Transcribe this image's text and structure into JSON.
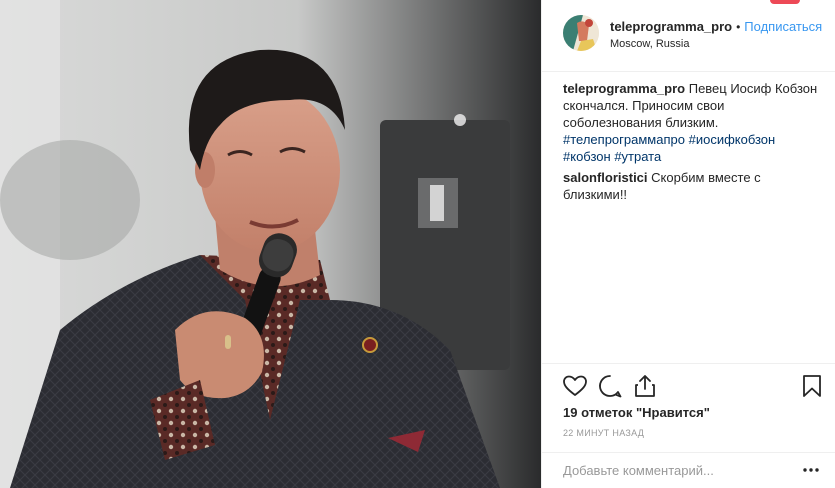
{
  "post": {
    "username": "teleprogramma_pro",
    "separator": "•",
    "follow_label": "Подписаться",
    "location": "Moscow, Russia"
  },
  "caption": {
    "username": "teleprogramma_pro",
    "text": "Певец Иосиф Кобзон скончался. Приносим свои соболезнования близким.",
    "hashtags": [
      "#телепрограммапро",
      "#иосифкобзон",
      "#кобзон",
      "#утрата"
    ]
  },
  "comments": [
    {
      "username": "salonfloristici",
      "text": "Скорбим вместе с близкими!!"
    }
  ],
  "actions": {
    "likes_text": "19 отметок \"Нравится\"",
    "time_ago": "22 МИНУТ НАЗАД",
    "comment_placeholder": "Добавьте комментарий..."
  },
  "icons": {
    "like": "heart-outline-icon",
    "comment": "speech-bubble-icon",
    "share": "share-upload-icon",
    "save": "bookmark-icon",
    "more": "ellipsis-icon"
  },
  "colors": {
    "link_blue": "#3897f0",
    "hashtag_blue": "#003569",
    "muted_gray": "#999999",
    "border": "#efefef",
    "badge_red": "#ed4956"
  }
}
